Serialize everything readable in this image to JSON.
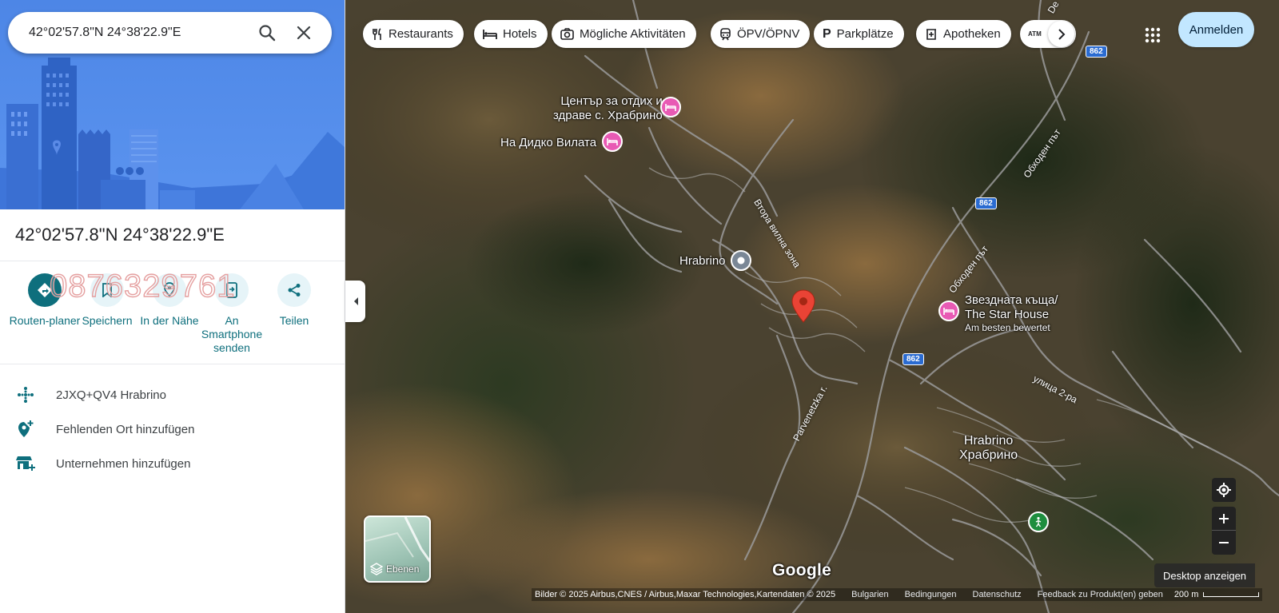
{
  "search": {
    "value": "42°02'57.8\"N 24°38'22.9\"E"
  },
  "place": {
    "title": "42°02'57.8\"N 24°38'22.9\"E"
  },
  "watermark": "0876329761",
  "actions": [
    {
      "label": "Routen-planer",
      "icon": "directions-icon"
    },
    {
      "label": "Speichern",
      "icon": "bookmark-icon"
    },
    {
      "label": "In der Nähe",
      "icon": "nearby-icon"
    },
    {
      "label": "An Smartphone senden",
      "icon": "send-to-phone-icon"
    },
    {
      "label": "Teilen",
      "icon": "share-icon"
    }
  ],
  "info_rows": [
    {
      "text": "2JXQ+QV4 Hrabrino",
      "icon": "plus-code-icon"
    },
    {
      "text": "Fehlenden Ort hinzufügen",
      "icon": "add-place-icon"
    },
    {
      "text": "Unternehmen hinzufügen",
      "icon": "add-business-icon"
    }
  ],
  "chips": [
    {
      "label": "Restaurants",
      "icon": "restaurant-icon"
    },
    {
      "label": "Hotels",
      "icon": "hotel-icon"
    },
    {
      "label": "Mögliche Aktivitäten",
      "icon": "camera-icon"
    },
    {
      "label": "ÖPV/ÖPNV",
      "icon": "transit-icon"
    },
    {
      "label": "Parkplätze",
      "icon": "parking-icon"
    },
    {
      "label": "Apotheken",
      "icon": "pharmacy-icon"
    },
    {
      "label": "",
      "icon": "atm-icon"
    }
  ],
  "header": {
    "signin": "Anmelden"
  },
  "map_labels": {
    "poi1_line1": "Център за отдих и",
    "poi1_line2": "здраве с. Храбрино",
    "poi2": "На Дидко Вилата",
    "hrabrino_small": "Hrabrino",
    "poi3_line1": "Звездната къща/",
    "poi3_line2": "The Star House",
    "poi3_sub": "Am besten bewertet",
    "town_latin": "Hrabrino",
    "town_cyr": "Храбрино",
    "road1": "Втора вилна зона",
    "road2": "Обходен път",
    "road3": "Обходен път",
    "road4": "улица 2-ра",
    "road5": "Parvenetzka r.",
    "shield_a": "862",
    "shield_b": "862",
    "shield_c": "862",
    "road_top": "De"
  },
  "map_controls": {
    "layers": "Ebenen",
    "desktop": "Desktop anzeigen",
    "google": "Google"
  },
  "footer": {
    "attribution": "Bilder © 2025 Airbus,CNES / Airbus,Maxar Technologies,Kartendaten © 2025",
    "country": "Bulgarien",
    "terms": "Bedingungen",
    "privacy": "Datenschutz",
    "feedback": "Feedback zu Produkt(en) geben",
    "scale": "200 m"
  },
  "colors": {
    "accent": "#0e6f7d",
    "accent_light": "#e6f4f8",
    "hero_blue": "#4d86e6",
    "signin_bg": "#c2e7ff",
    "poi_pink": "#e85ab4",
    "pin_red": "#ea4335",
    "shield_blue": "#2a6bd1"
  }
}
